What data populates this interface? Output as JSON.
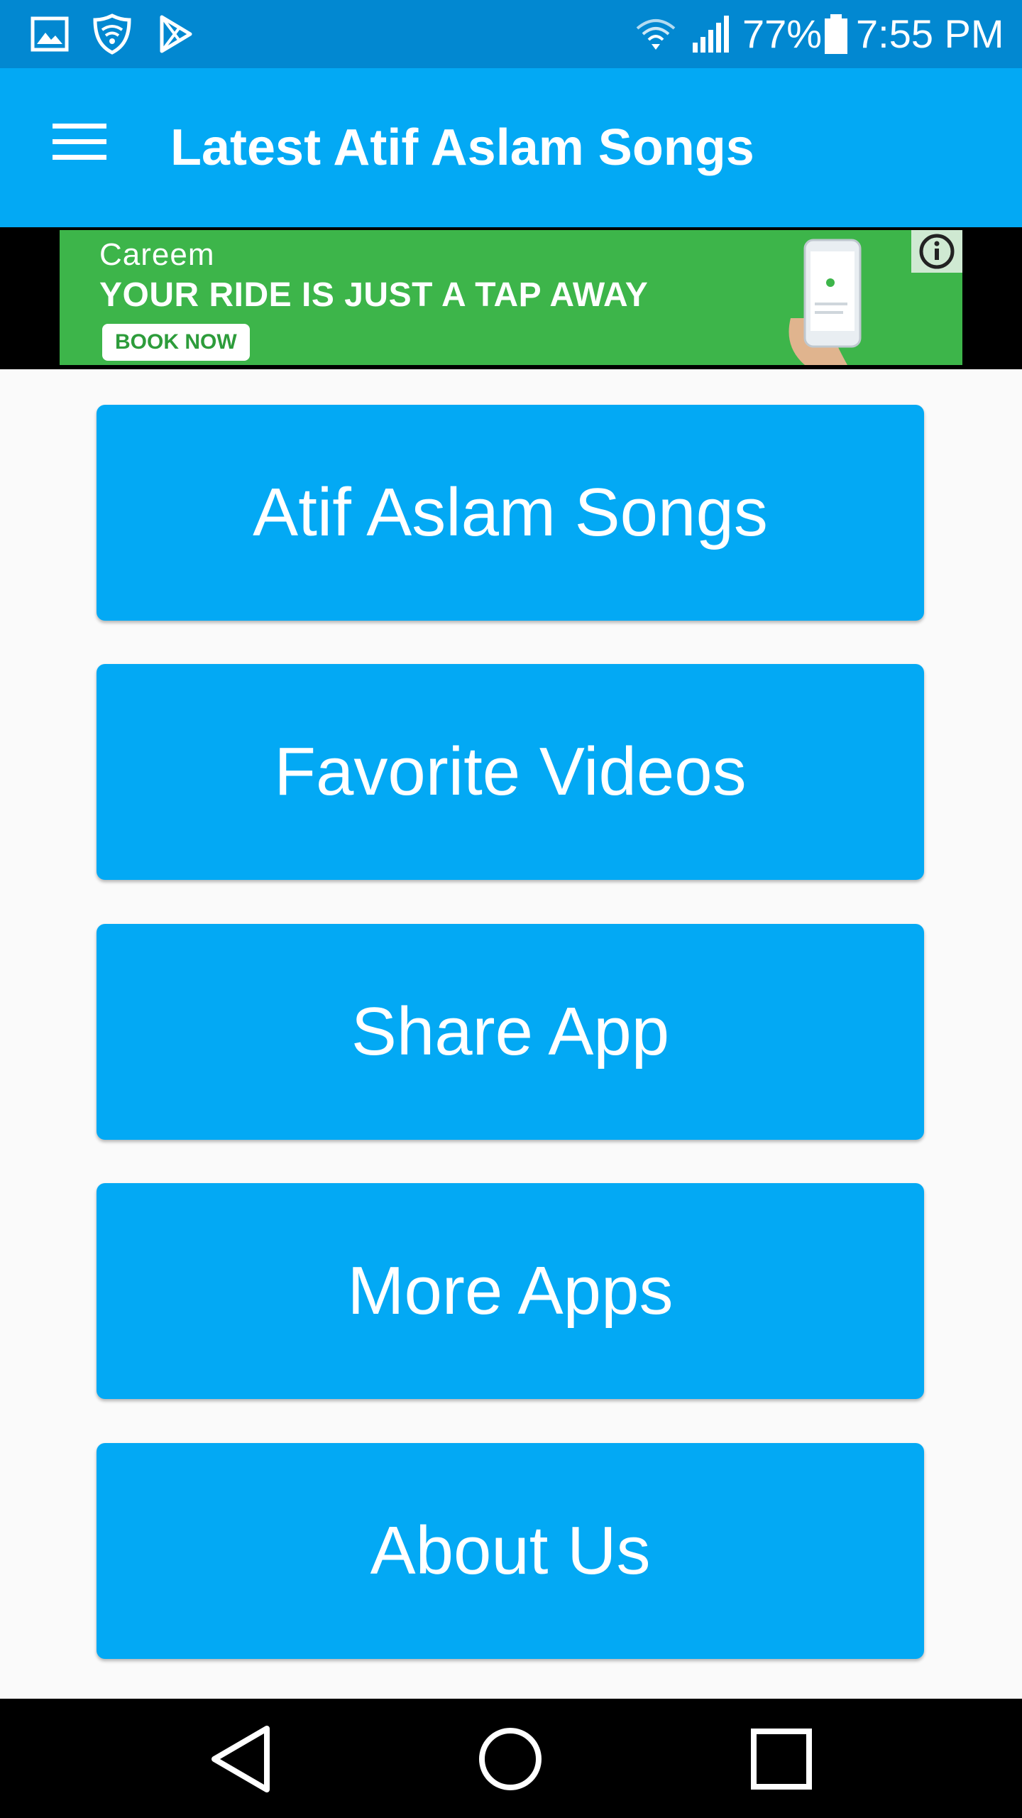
{
  "status_bar": {
    "battery_percent": "77%",
    "time": "7:55 PM",
    "icons": [
      "gallery-icon",
      "shield-icon",
      "play-store-icon",
      "wifi-icon",
      "signal-icon",
      "battery-icon"
    ]
  },
  "app_bar": {
    "title": "Latest Atif Aslam Songs",
    "menu_icon": "hamburger-menu-icon"
  },
  "ad": {
    "brand": "Careem",
    "headline": "YOUR RIDE IS JUST A TAP AWAY",
    "cta": "BOOK NOW",
    "background_color": "#3db54a",
    "info_icon": "info-icon"
  },
  "menu": {
    "items": [
      {
        "label": "Atif Aslam Songs"
      },
      {
        "label": "Favorite Videos"
      },
      {
        "label": "Share App"
      },
      {
        "label": "More Apps"
      },
      {
        "label": "About Us"
      }
    ],
    "button_color": "#03a9f4"
  },
  "nav_bar": {
    "icons": [
      "back-icon",
      "home-icon",
      "recents-icon"
    ]
  },
  "colors": {
    "status_bar": "#0288d1",
    "app_bar": "#03a9f4",
    "background": "#fafafa"
  }
}
